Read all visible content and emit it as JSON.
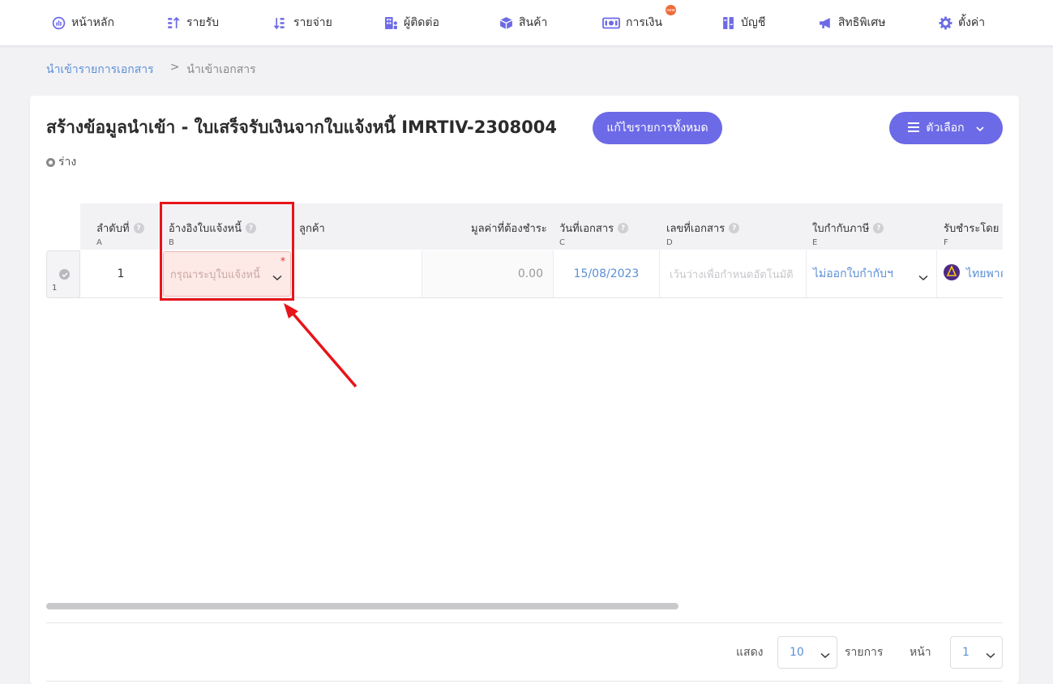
{
  "nav": {
    "items": [
      {
        "label": "หน้าหลัก",
        "icon": "dashboard-icon"
      },
      {
        "label": "รายรับ",
        "icon": "income-icon"
      },
      {
        "label": "รายจ่าย",
        "icon": "expense-icon"
      },
      {
        "label": "ผู้ติดต่อ",
        "icon": "contacts-icon"
      },
      {
        "label": "สินค้า",
        "icon": "box-icon"
      },
      {
        "label": "การเงิน",
        "icon": "money-icon"
      },
      {
        "label": "บัญชี",
        "icon": "ledger-icon"
      },
      {
        "label": "สิทธิพิเศษ",
        "icon": "megaphone-icon"
      },
      {
        "label": "ตั้งค่า",
        "icon": "gear-icon"
      }
    ],
    "new_badge": "new"
  },
  "breadcrumb": {
    "parent": "นำเข้ารายการเอกสาร",
    "separator": ">",
    "current": "นำเข้าเอกสาร"
  },
  "page": {
    "title": "สร้างข้อมูลนำเข้า - ใบเสร็จรับเงินจากใบแจ้งหนี้ IMRTIV-2308004",
    "edit_all_label": "แก้ไขรายการทั้งหมด",
    "options_label": "ตัวเลือก",
    "status": "ร่าง"
  },
  "table": {
    "columns": [
      {
        "label": "ลำดับที่",
        "col": "A",
        "help": true
      },
      {
        "label": "อ้างอิงใบแจ้งหนี้",
        "col": "B",
        "help": true
      },
      {
        "label": "ลูกค้า",
        "col": "",
        "help": false
      },
      {
        "label": "มูลค่าที่ต้องชำระ",
        "col": "",
        "help": false
      },
      {
        "label": "วันที่เอกสาร",
        "col": "C",
        "help": true
      },
      {
        "label": "เลขที่เอกสาร",
        "col": "D",
        "help": true
      },
      {
        "label": "ใบกำกับภาษี",
        "col": "E",
        "help": true
      },
      {
        "label": "รับชำระโดย",
        "col": "F",
        "help": false
      }
    ],
    "row": {
      "row_number": "1",
      "seq": "1",
      "invoice_ref_placeholder": "กรุณาระบุใบแจ้งหนี้",
      "required_mark": "*",
      "customer": "",
      "amount_due": "0.00",
      "doc_date": "15/08/2023",
      "doc_no_placeholder": "เว้นว่างเพื่อกำหนดอัตโนมัติ",
      "tax_invoice": "ไม่ออกใบกำกับฯ",
      "paid_by": "ไทยพาณิชย์"
    }
  },
  "pagination": {
    "show_label": "แสดง",
    "per_page": "10",
    "items_label": "รายการ",
    "page_label": "หน้า",
    "page": "1"
  },
  "colors": {
    "accent": "#6c6ae6",
    "link": "#5b8fd6",
    "highlight": "#e8141b"
  }
}
